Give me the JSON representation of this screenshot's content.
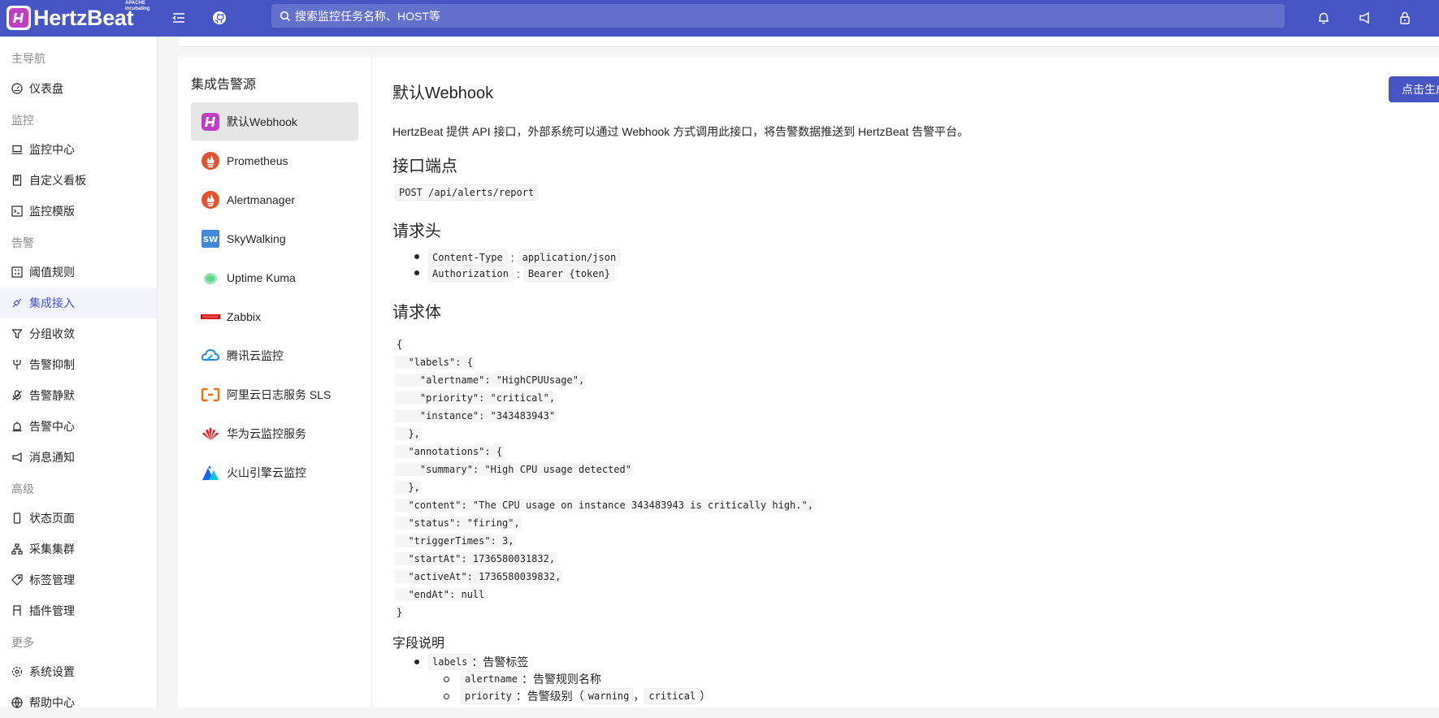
{
  "header": {
    "logo_text": "HertzBeat",
    "logo_sup": "APACHE incubating",
    "search_placeholder": "搜索监控任务名称、HOST等",
    "icons": [
      "menu-fold-icon",
      "github-icon",
      "bell-icon",
      "notification-icon",
      "lock-icon"
    ]
  },
  "sidebar": {
    "groups": {
      "main": "主导航",
      "monitor": "监控",
      "alert": "告警",
      "advanced": "高级",
      "more": "更多"
    },
    "items": [
      {
        "label": "仪表盘",
        "icon": "dashboard-icon"
      },
      {
        "label": "监控中心",
        "icon": "laptop-icon"
      },
      {
        "label": "自定义看板",
        "icon": "book-icon"
      },
      {
        "label": "监控模版",
        "icon": "code-icon"
      },
      {
        "label": "阈值规则",
        "icon": "calculator-icon"
      },
      {
        "label": "集成接入",
        "icon": "api-icon",
        "active": true
      },
      {
        "label": "分组收敛",
        "icon": "filter-icon"
      },
      {
        "label": "告警抑制",
        "icon": "fork-icon"
      },
      {
        "label": "告警静默",
        "icon": "audio-muted-icon"
      },
      {
        "label": "告警中心",
        "icon": "alert-icon"
      },
      {
        "label": "消息通知",
        "icon": "sound-icon"
      },
      {
        "label": "状态页面",
        "icon": "mobile-icon"
      },
      {
        "label": "采集集群",
        "icon": "cluster-icon"
      },
      {
        "label": "标签管理",
        "icon": "tag-icon"
      },
      {
        "label": "插件管理",
        "icon": "plugin-icon"
      },
      {
        "label": "系统设置",
        "icon": "setting-icon"
      },
      {
        "label": "帮助中心",
        "icon": "global-icon"
      }
    ]
  },
  "sources": {
    "title": "集成告警源",
    "items": [
      {
        "label": "默认Webhook",
        "icon": "hertzbeat-icon",
        "active": true
      },
      {
        "label": "Prometheus",
        "icon": "prometheus-icon"
      },
      {
        "label": "Alertmanager",
        "icon": "alertmanager-icon"
      },
      {
        "label": "SkyWalking",
        "icon": "skywalking-icon"
      },
      {
        "label": "Uptime Kuma",
        "icon": "uptime-kuma-icon"
      },
      {
        "label": "Zabbix",
        "icon": "zabbix-icon"
      },
      {
        "label": "腾讯云监控",
        "icon": "tencent-cloud-icon"
      },
      {
        "label": "阿里云日志服务 SLS",
        "icon": "aliyun-icon"
      },
      {
        "label": "华为云监控服务",
        "icon": "huawei-icon"
      },
      {
        "label": "火山引擎云监控",
        "icon": "volcengine-icon"
      }
    ]
  },
  "doc": {
    "title": "默认Webhook",
    "gen_button": "点击生成",
    "intro": "HertzBeat 提供 API 接口，外部系统可以通过 Webhook 方式调用此接口，将告警数据推送到 HertzBeat 告警平台。",
    "endpoint_heading": "接口端点",
    "endpoint": "POST /api/alerts/report",
    "headers_heading": "请求头",
    "headers": [
      {
        "key": "Content-Type",
        "value": "application/json"
      },
      {
        "key": "Authorization",
        "value": "Bearer {token}"
      }
    ],
    "body_heading": "请求体",
    "body_lines": [
      "{",
      "  \"labels\": {",
      "    \"alertname\": \"HighCPUUsage\",",
      "    \"priority\": \"critical\",",
      "    \"instance\": \"343483943\"",
      "  },",
      "  \"annotations\": {",
      "    \"summary\": \"High CPU usage detected\"",
      "  },",
      "  \"content\": \"The CPU usage on instance 343483943 is critically high.\",",
      "  \"status\": \"firing\",",
      "  \"triggerTimes\": 3,",
      "  \"startAt\": 1736580031832,",
      "  \"activeAt\": 1736580039832,",
      "  \"endAt\": null",
      "}"
    ],
    "fields_heading": "字段说明",
    "fields": {
      "labels_key": "labels",
      "labels_desc": "：告警标签",
      "alertname_key": "alertname",
      "alertname_desc": "：告警规则名称",
      "priority_key": "priority",
      "priority_desc_a": "：告警级别（",
      "priority_warning": "warning",
      "priority_sep": "，",
      "priority_critical": "critical",
      "priority_desc_b": "）"
    }
  }
}
